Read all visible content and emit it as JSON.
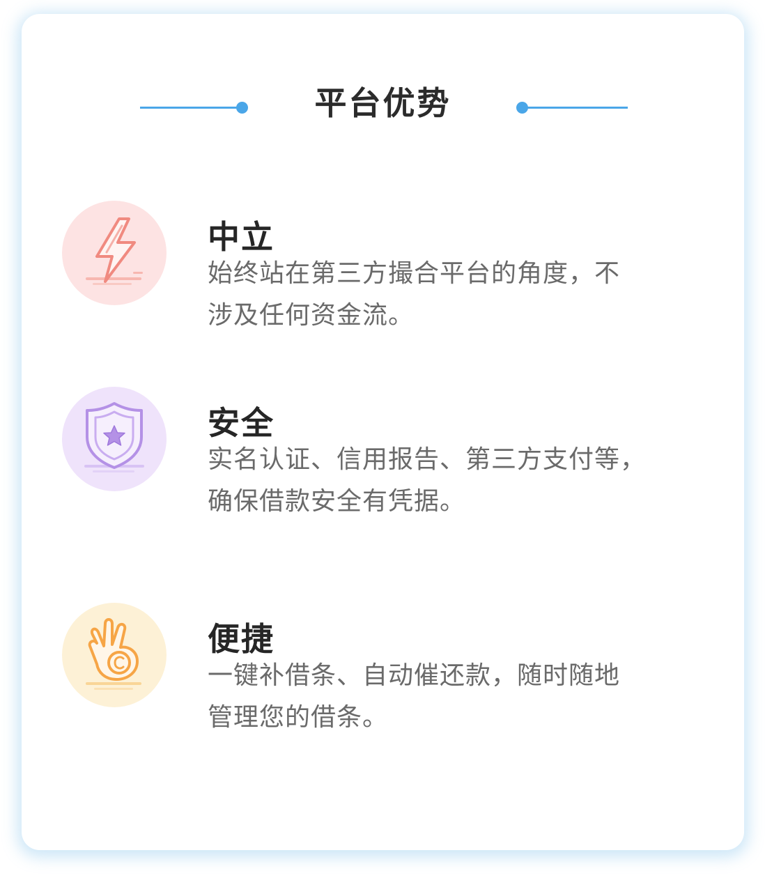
{
  "header": {
    "title": "平台优势",
    "accent_color": "#4aa6e8"
  },
  "features": [
    {
      "icon": "lightning-icon",
      "title": "中立",
      "desc_lines": [
        "始终站在第三方撮合平台的角度，不",
        "涉及任何资金流。"
      ],
      "icon_bg": "#fde3e3",
      "icon_color": "#f08a80"
    },
    {
      "icon": "shield-star-icon",
      "title": "安全",
      "desc_lines": [
        "实名认证、信用报告、第三方支付等，",
        "确保借款安全有凭据。"
      ],
      "icon_bg": "#efe3fb",
      "icon_color": "#b491e6"
    },
    {
      "icon": "ok-hand-icon",
      "title": "便捷",
      "desc_lines": [
        "一键补借条、自动催还款，随时随地",
        "管理您的借条。"
      ],
      "icon_bg": "#fdf1d6",
      "icon_color": "#f6a546"
    }
  ]
}
